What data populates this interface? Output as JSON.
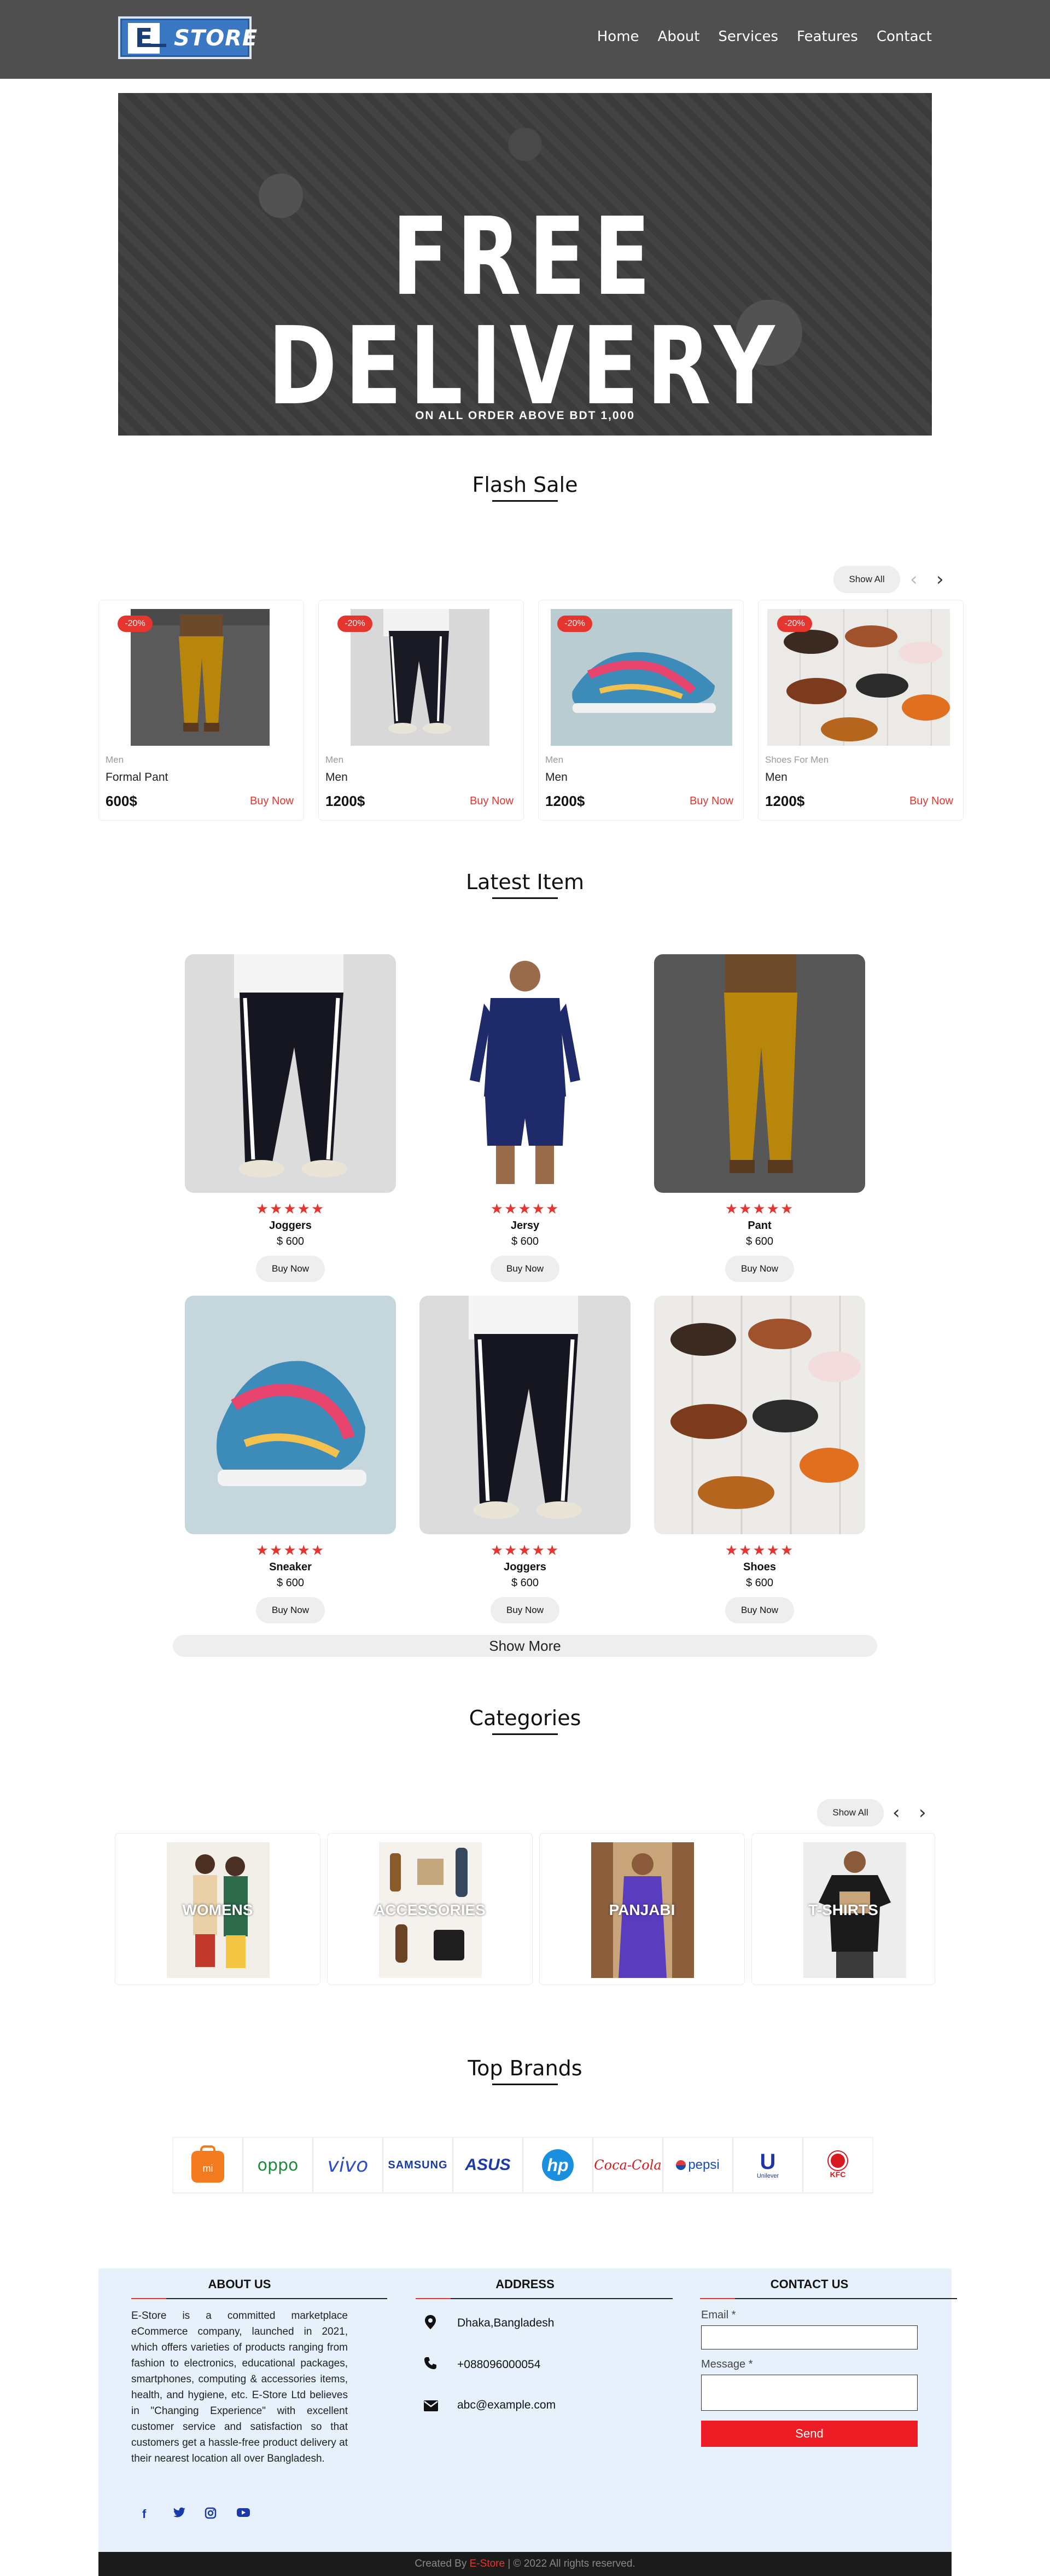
{
  "nav": {
    "items": [
      "Home",
      "About",
      "Services",
      "Features",
      "Contact"
    ]
  },
  "logo": {
    "e": "E",
    "store": "STORE"
  },
  "banner": {
    "headline": "FREE DELIVERY",
    "sub": "ON ALL ORDER ABOVE BDT 1,000"
  },
  "flash": {
    "title": "Flash Sale",
    "show_all": "Show All",
    "cards": [
      {
        "badge": "-20%",
        "cat": "Men",
        "name": "Formal Pant",
        "price": "600$",
        "buy": "Buy Now"
      },
      {
        "badge": "-20%",
        "cat": "Men",
        "name": "Men",
        "price": "1200$",
        "buy": "Buy Now"
      },
      {
        "badge": "-20%",
        "cat": "Men",
        "name": "Men",
        "price": "1200$",
        "buy": "Buy Now"
      },
      {
        "badge": "-20%",
        "cat": "Shoes For Men",
        "name": "Men",
        "price": "1200$",
        "buy": "Buy Now"
      }
    ]
  },
  "latest": {
    "title": "Latest Item",
    "stars": "★★★★★",
    "items": [
      {
        "name": "Joggers",
        "price": "$ 600",
        "buy": "Buy Now"
      },
      {
        "name": "Jersy",
        "price": "$ 600",
        "buy": "Buy Now"
      },
      {
        "name": "Pant",
        "price": "$ 600",
        "buy": "Buy Now"
      },
      {
        "name": "Sneaker",
        "price": "$ 600",
        "buy": "Buy Now"
      },
      {
        "name": "Joggers",
        "price": "$ 600",
        "buy": "Buy Now"
      },
      {
        "name": "Shoes",
        "price": "$ 600",
        "buy": "Buy Now"
      }
    ],
    "show_more": "Show More"
  },
  "categories": {
    "title": "Categories",
    "show_all": "Show All",
    "items": [
      "WOMENS",
      "ACCESSORIES",
      "PANJABI",
      "T-SHIRTS"
    ]
  },
  "brands": {
    "title": "Top Brands",
    "items": [
      "mi",
      "oppo",
      "vivo",
      "SAMSUNG",
      "ASUS",
      "hp",
      "Coca-Cola",
      "pepsi",
      "Unilever",
      "KFC"
    ]
  },
  "footer": {
    "about_title": "ABOUT US",
    "about_text": "E-Store is a committed marketplace eCommerce company, launched in 2021, which offers varieties of products ranging from fashion to electronics, educational packages, smartphones, computing & accessories items, health, and hygiene, etc. E-Store Ltd believes in \"Changing Experience\" with excellent customer service and satisfaction so that customers get a hassle-free product delivery at their nearest location all over Bangladesh.",
    "address_title": "ADDRESS",
    "address": "Dhaka,Bangladesh",
    "phone": "+088096000054",
    "email": "abc@example.com",
    "contact_title": "CONTACT US",
    "email_label": "Email *",
    "message_label": "Message *",
    "send": "Send",
    "copy_prefix": "Created By ",
    "copy_brand": "E-Store",
    "copy_suffix": " | © 2022 All rights reserved."
  }
}
